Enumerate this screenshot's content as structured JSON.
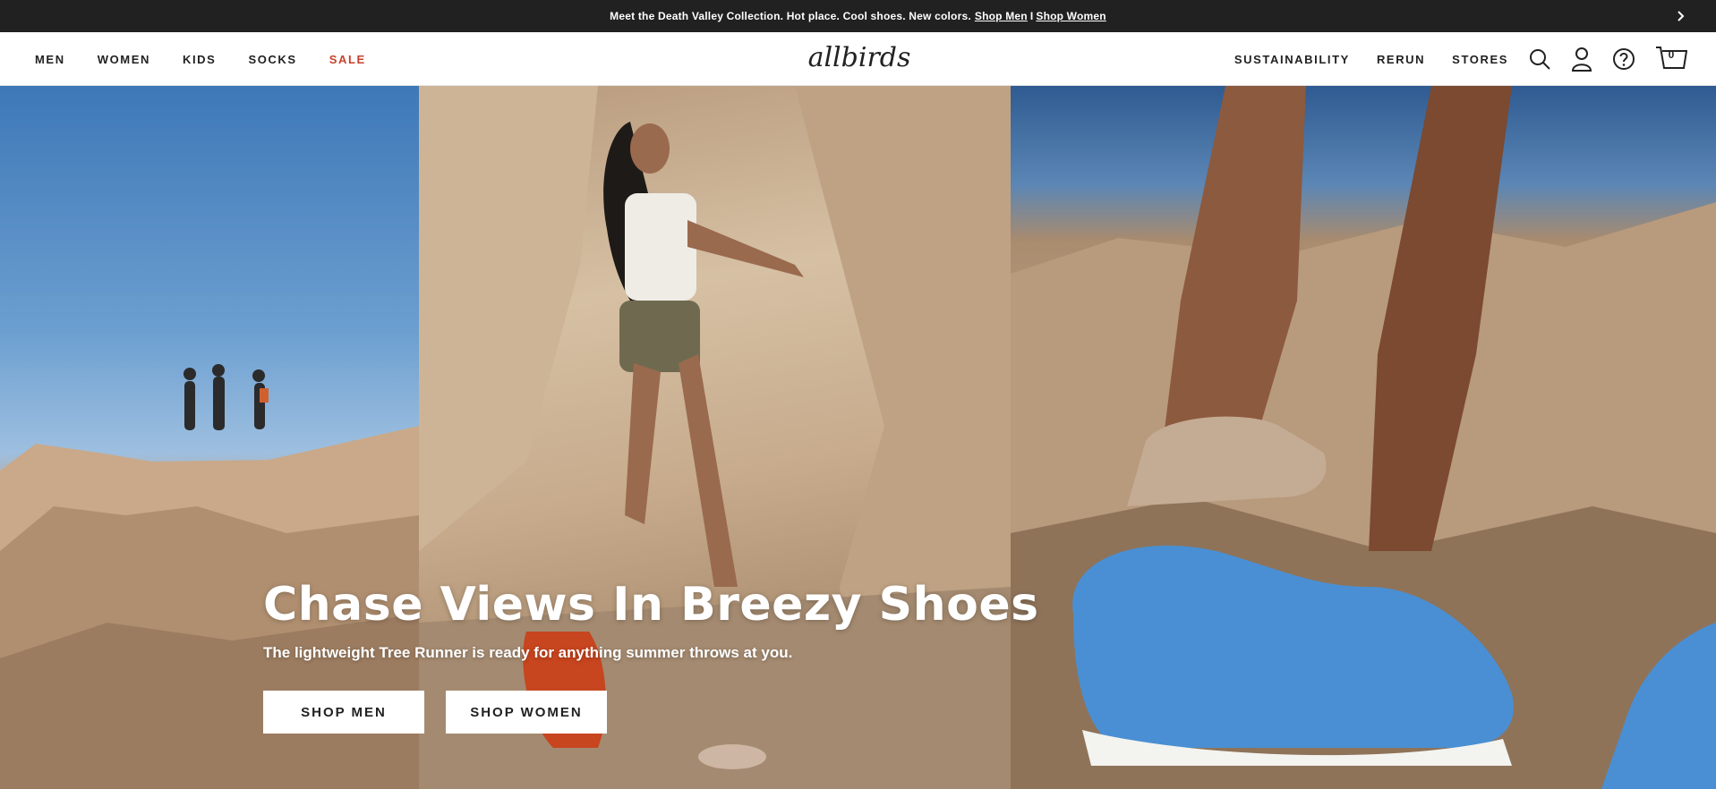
{
  "announcement": {
    "message": "Meet the Death Valley Collection. Hot place. Cool shoes. New colors.",
    "link_men": "Shop Men",
    "separator": "I",
    "link_women": "Shop Women",
    "next_icon": "chevron-right-icon"
  },
  "header": {
    "logo_text": "allbirds",
    "nav_left": [
      "MEN",
      "WOMEN",
      "KIDS",
      "SOCKS",
      "SALE"
    ],
    "nav_right": [
      "SUSTAINABILITY",
      "RERUN",
      "STORES"
    ],
    "icons": [
      "search-icon",
      "account-icon",
      "help-icon",
      "cart-icon"
    ],
    "cart_count": "0",
    "sale_color": "#c8412b"
  },
  "hero": {
    "title": "Chase Views In Breezy Shoes",
    "subtitle": "The lightweight Tree Runner is ready for anything summer throws at you.",
    "cta_men": "SHOP MEN",
    "cta_women": "SHOP WOMEN"
  }
}
